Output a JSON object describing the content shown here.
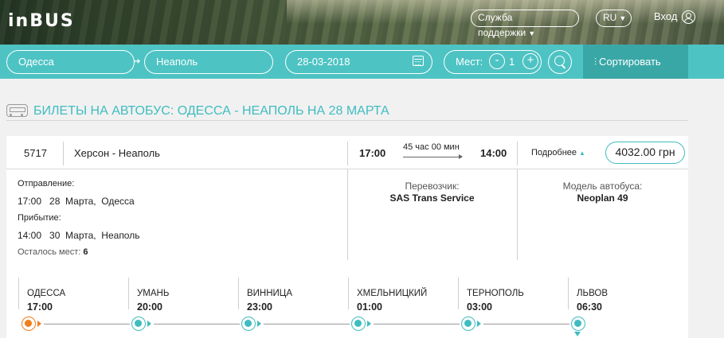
{
  "header": {
    "logo": "inBUS",
    "support_label": "Служба поддержки",
    "language": "RU",
    "login_label": "Вход"
  },
  "search": {
    "from": "Одесса",
    "to": "Неаполь",
    "date": "28-03-2018",
    "seats_label": "Мест:",
    "seats_minus": "-",
    "seats_value": "1",
    "seats_plus": "+",
    "sort_label": "Сортировать"
  },
  "page_title": "БИЛЕТЫ НА АВТОБУС: ОДЕССА - НЕАПОЛЬ НА 28 МАРТА",
  "trip": {
    "number": "5717",
    "route": "Херсон - Неаполь",
    "departure_time": "17:00",
    "duration": "45 час 00 мин",
    "arrival_time": "14:00",
    "details_label": "Подробнее",
    "price": "4032.00 грн",
    "departure_label": "Отправление:",
    "departure_line": "17:00   28  Марта,  Одесса",
    "arrival_label": "Прибытие:",
    "arrival_line": "14:00   30  Марта,  Неаполь",
    "seats_left_label": "Осталось мест:",
    "seats_left": "6",
    "carrier_label": "Перевозчик:",
    "carrier": "SAS Trans Service",
    "bus_model_label": "Модель автобуса:",
    "bus_model": "Neoplan 49"
  },
  "stops": [
    {
      "city": "ОДЕССА",
      "time": "17:00"
    },
    {
      "city": "УМАНЬ",
      "time": "20:00"
    },
    {
      "city": "ВИННИЦА",
      "time": "23:00"
    },
    {
      "city": "ХМЕЛЬНИЦКИЙ",
      "time": "01:00"
    },
    {
      "city": "ТЕРНОПОЛЬ",
      "time": "03:00"
    },
    {
      "city": "ЛЬВОВ",
      "time": "06:30"
    }
  ],
  "colors": {
    "accent": "#4ec3c3",
    "accent_dark": "#3aa7a7",
    "origin_marker": "#f07e1c"
  },
  "icons": [
    "user-icon",
    "calendar-icon",
    "search-icon",
    "sort-filter-icon",
    "bus-icon",
    "chevron-down-icon"
  ]
}
